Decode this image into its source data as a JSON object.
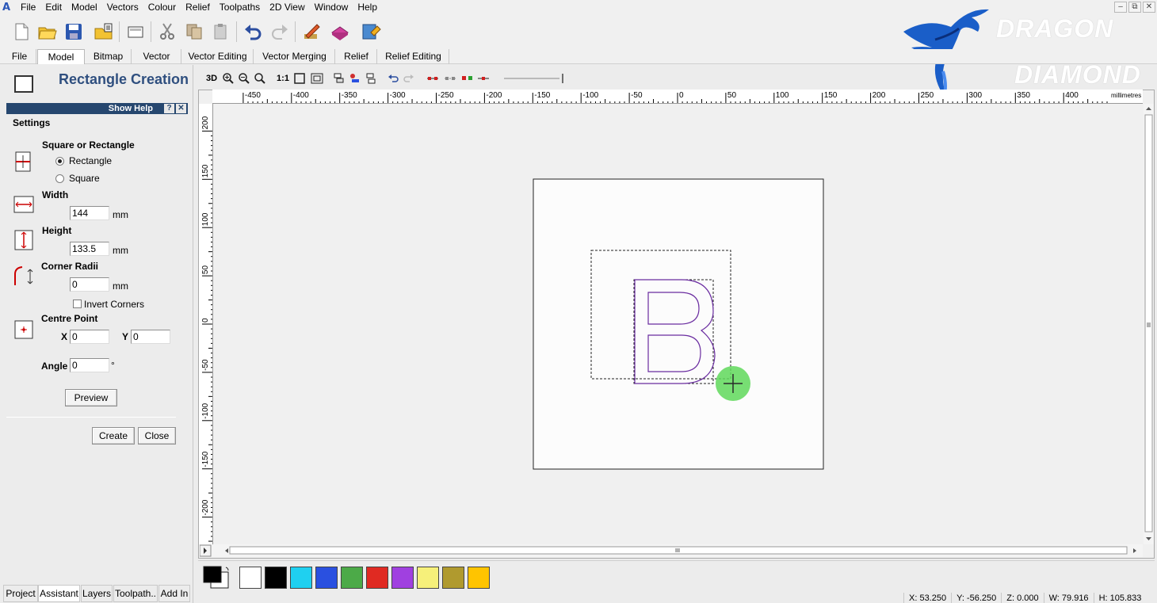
{
  "menu": [
    "File",
    "Edit",
    "Model",
    "Vectors",
    "Colour",
    "Relief",
    "Toolpaths",
    "2D View",
    "Window",
    "Help"
  ],
  "window_buttons": [
    "–",
    "⧉",
    "✕"
  ],
  "logo": {
    "line1": "DRAGON",
    "line2": "DIAMOND"
  },
  "tabs": [
    "File",
    "Model",
    "Bitmap",
    "Vector",
    "Vector Editing",
    "Vector Merging",
    "Relief",
    "Relief Editing"
  ],
  "active_tab": "Model",
  "panel": {
    "title": "Rectangle Creation",
    "help_label": "Show Help",
    "help_q": "?",
    "help_x": "✕",
    "settings_label": "Settings",
    "shape_label": "Square or Rectangle",
    "opt_rectangle": "Rectangle",
    "opt_square": "Square",
    "selected_shape": "Rectangle",
    "width_label": "Width",
    "width_value": "144",
    "height_label": "Height",
    "height_value": "133.5",
    "radius_label": "Corner Radii",
    "radius_value": "0",
    "unit": "mm",
    "invert_label": "Invert Corners",
    "invert_checked": false,
    "centre_label": "Centre Point",
    "x_label": "X",
    "x_value": "0",
    "y_label": "Y",
    "y_value": "0",
    "angle_label": "Angle",
    "angle_value": "0",
    "angle_unit": "°",
    "preview_btn": "Preview",
    "create_btn": "Create",
    "close_btn": "Close"
  },
  "bottom_tabs": [
    "Project",
    "Assistant",
    "Layers",
    "Toolpath..",
    "Add In"
  ],
  "active_bottom_tab": "Assistant",
  "view_toolbar": {
    "mode_3d": "3D",
    "scale_1to1": "1:1"
  },
  "ruler": {
    "h_ticks": [
      "-450",
      "-400",
      "-350",
      "-300",
      "-250",
      "-200",
      "-150",
      "-100",
      "-50",
      "0",
      "50",
      "100",
      "150",
      "200",
      "250",
      "300",
      "350",
      "400"
    ],
    "v_ticks": [
      "200",
      "150",
      "100",
      "50",
      "0",
      "-50",
      "-100",
      "-150",
      "-200"
    ],
    "units": "millimetres"
  },
  "palette": [
    "#ffffff",
    "#000000",
    "#1fd0f0",
    "#2a50e0",
    "#4caa48",
    "#e02a22",
    "#a040e0",
    "#f6f07a",
    "#b09a2e",
    "#ffc400"
  ],
  "palette_current": {
    "fg": "#000000",
    "bg": "#ffffff"
  },
  "drawing": {
    "letter": "B",
    "outline_color": "#6a2ca0"
  },
  "status": {
    "x": "X: 53.250",
    "y": "Y: -56.250",
    "z": "Z: 0.000",
    "w": "W: 79.916",
    "h": "H: 105.833"
  }
}
